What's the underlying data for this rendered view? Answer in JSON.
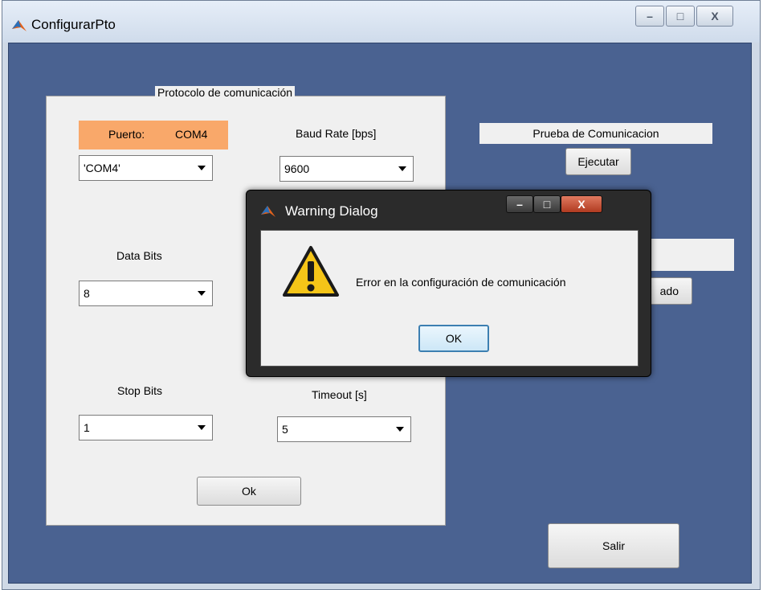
{
  "main_window": {
    "title": "ConfigurarPto",
    "controls": {
      "minimize": "–",
      "maximize": "□",
      "close": "X"
    }
  },
  "protocol_panel": {
    "title": "Protocolo de comunicación",
    "port_label": "Puerto:",
    "port_value": "COM4",
    "port_select_value": "'COM4'",
    "baud_label": "Baud Rate [bps]",
    "baud_value": "9600",
    "data_bits_label": "Data Bits",
    "data_bits_value": "8",
    "stop_bits_label": "Stop Bits",
    "stop_bits_value": "1",
    "timeout_label": "Timeout [s]",
    "timeout_value": "5",
    "ok_button": "Ok"
  },
  "comm_test": {
    "label": "Prueba de Comunicacion",
    "execute_button": "Ejecutar",
    "hidden_button_fragment": "ado"
  },
  "exit_button": "Salir",
  "warning_dialog": {
    "title": "Warning Dialog",
    "message": "Error en la configuración de comunicación",
    "ok_button": "OK",
    "controls": {
      "minimize": "–",
      "maximize": "□",
      "close": "X"
    }
  },
  "colors": {
    "client_background": "#4a6291",
    "port_highlight": "#f9a86a",
    "dialog_frame": "#2b2b2b",
    "close_button": "#c7462f"
  }
}
